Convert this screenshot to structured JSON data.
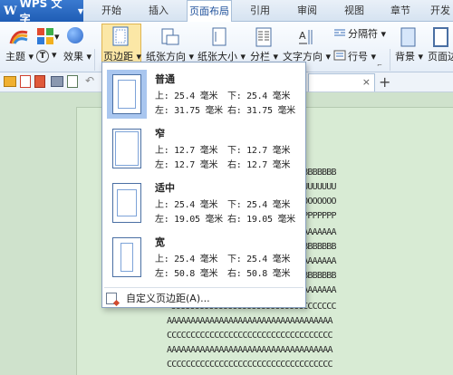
{
  "app": {
    "name": "WPS 文字",
    "logo": "W"
  },
  "tabs": [
    {
      "label": "开始",
      "active": false
    },
    {
      "label": "插入",
      "active": false
    },
    {
      "label": "页面布局",
      "active": true
    },
    {
      "label": "引用",
      "active": false
    },
    {
      "label": "审阅",
      "active": false
    },
    {
      "label": "视图",
      "active": false
    },
    {
      "label": "章节",
      "active": false
    },
    {
      "label": "开发",
      "active": false
    }
  ],
  "ribbon": {
    "theme": "主题",
    "font": "T",
    "effects": "效果",
    "margins": "页边距",
    "orientation": "纸张方向",
    "size": "纸张大小",
    "columns": "分栏",
    "text_direction": "文字方向",
    "breaks": "分隔符",
    "line_numbers": "行号",
    "background": "背景",
    "page_border": "页面边"
  },
  "margins_menu": {
    "options": [
      {
        "name": "普通",
        "top": "上: 25.4 毫米",
        "bottom": "下: 25.4 毫米",
        "left": "左: 31.75 毫米",
        "right": "右: 31.75 毫米"
      },
      {
        "name": "窄",
        "top": "上: 12.7 毫米",
        "bottom": "下: 12.7 毫米",
        "left": "左: 12.7 毫米",
        "right": "右: 12.7 毫米"
      },
      {
        "name": "适中",
        "top": "上: 25.4 毫米",
        "bottom": "下: 25.4 毫米",
        "left": "左: 19.05 毫米",
        "right": "右: 19.05 毫米"
      },
      {
        "name": "宽",
        "top": "上: 25.4 毫米",
        "bottom": "下: 25.4 毫米",
        "left": "左: 50.8 毫米",
        "right": "右: 50.8 毫米"
      }
    ],
    "custom": "自定义页边距(A)..."
  },
  "document": {
    "lines": [
      "BBBBBBBBBBBBBBBBBBBBBBBBBBBBBBBBBBB",
      "UUUUUUUUUUUUUUUUUUUUUUUUUUUUUUUUUUU",
      "UOOOOOOOOOOOOOOOOOOOOOOOOOOOOOOOOOO",
      "PPPPPPPPPPPPPPPPPPPPPPPPPPPPPPPPPPP",
      "AAAAAAAAAAAAAAAAAAAAAAAAAAAAAAAAAAA",
      "BBBBBBBBBBBBBBBBBBBBBBBBBBBBBBBBBBB",
      "AAAAAAAAAAAAAAAAAAAAAAAAAAAAAAAAAAA",
      "BBBBBBBBBBBBBBBBBBBBBBBBBBBBBBBBBBB",
      "AAAAAAAAAAAAAAAAAAAAAAAAAAAAAAAAAAA",
      "CCCCCCCCCCCCCCCCCCCCCCCCCCCCCCCCCCC",
      "AAAAAAAAAAAAAAAAAAAAAAAAAAAAAAAAAAA",
      "CCCCCCCCCCCCCCCCCCCCCCCCCCCCCCCCCCC",
      "AAAAAAAAAAAAAAAAAAAAAAAAAAAAAAAAAAA",
      "CCCCCCCCCCCCCCCCCCCCCCCCCCCCCCCCCCC",
      "AAAAAAAAAAAAAAAAAAAAAAAAAAAAAAAAAAA"
    ]
  },
  "colors": {
    "accent": "#1f5db5",
    "page": "#d8ebd4",
    "canvas": "#cfe2cc"
  }
}
